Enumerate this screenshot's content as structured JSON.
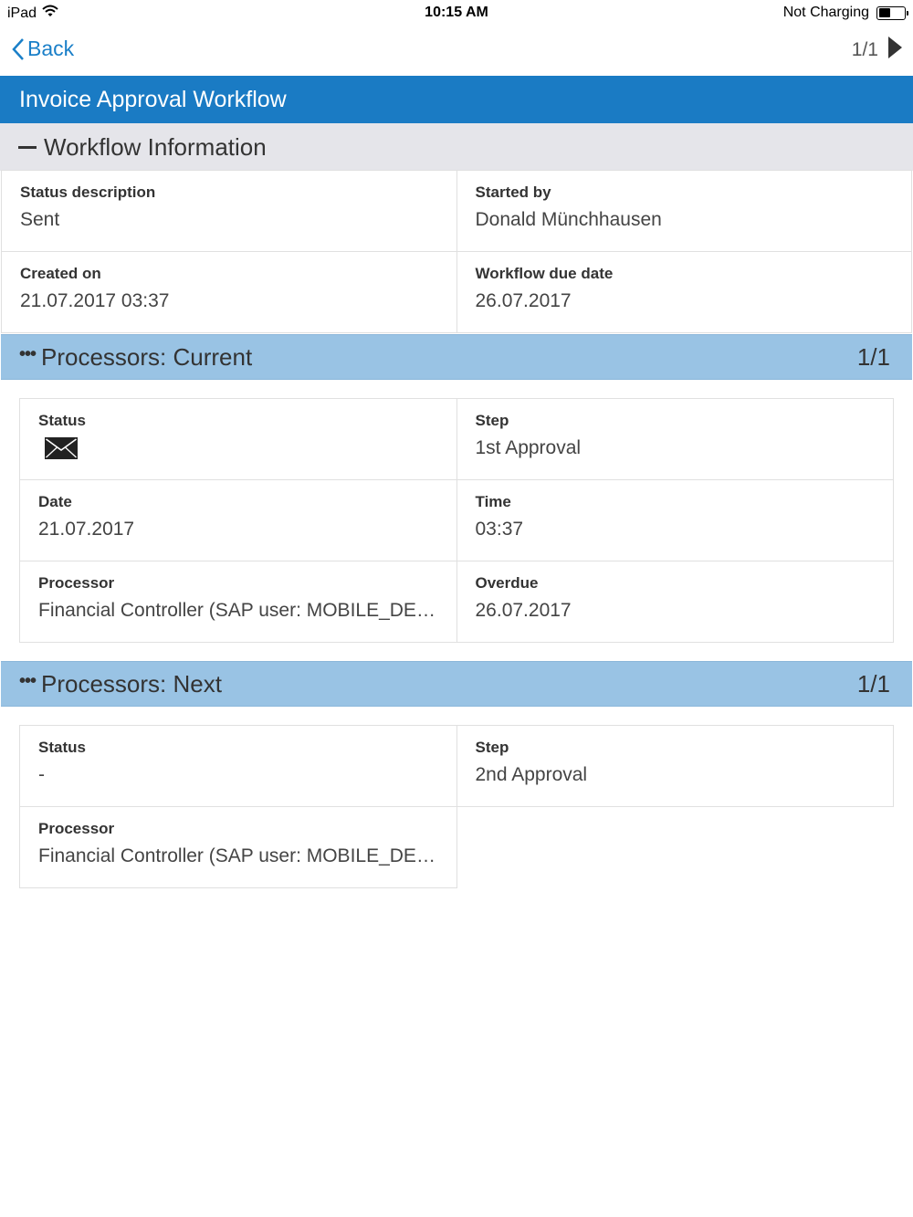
{
  "status_bar": {
    "device": "iPad",
    "time": "10:15 AM",
    "charging": "Not Charging",
    "battery_level": 0.45
  },
  "nav": {
    "back_label": "Back",
    "pager": "1/1"
  },
  "title": "Invoice Approval Workflow",
  "workflow_info": {
    "header": "Workflow Information",
    "fields": [
      {
        "label": "Status description",
        "value": "Sent"
      },
      {
        "label": "Started by",
        "value": "Donald Münchhausen"
      },
      {
        "label": "Created on",
        "value": "21.07.2017 03:37"
      },
      {
        "label": "Workflow due date",
        "value": "26.07.2017"
      }
    ]
  },
  "current": {
    "header": "Processors: Current",
    "count": "1/1",
    "fields": [
      {
        "label": "Status",
        "icon": "envelope-icon"
      },
      {
        "label": "Step",
        "value": "1st Approval"
      },
      {
        "label": "Date",
        "value": "21.07.2017"
      },
      {
        "label": "Time",
        "value": "03:37"
      },
      {
        "label": "Processor",
        "value": "Financial Controller (SAP user: MOBILE_DE…"
      },
      {
        "label": "Overdue",
        "value": "26.07.2017"
      }
    ]
  },
  "next": {
    "header": "Processors: Next",
    "count": "1/1",
    "fields": [
      {
        "label": "Status",
        "value": "-"
      },
      {
        "label": "Step",
        "value": "2nd Approval"
      },
      {
        "label": "Processor",
        "value": "Financial Controller (SAP user: MOBILE_DE…"
      }
    ]
  },
  "colors": {
    "title_bar": "#1a7bc4",
    "section_blue": "#99c3e4",
    "section_gray": "#e5e5ea",
    "link": "#1a7fc8"
  }
}
